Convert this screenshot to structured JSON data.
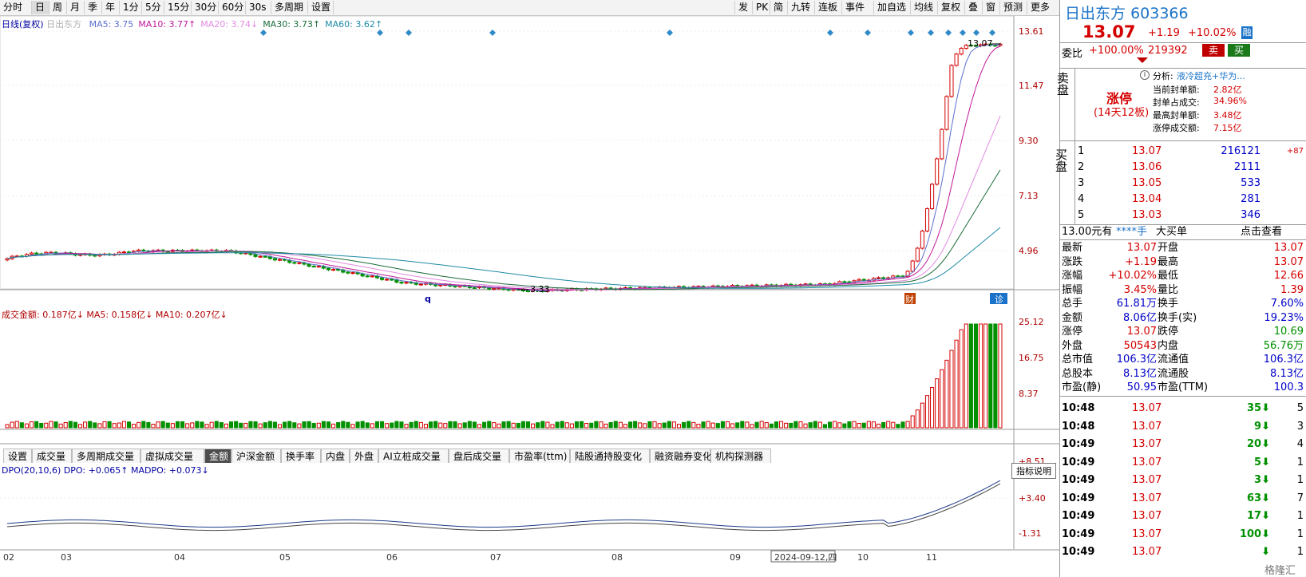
{
  "toolbar": {
    "left": [
      "分时",
      "日",
      "周",
      "月",
      "季",
      "年",
      "1分",
      "5分",
      "15分",
      "30分",
      "60分",
      "30s",
      "多周期",
      "设置"
    ],
    "active": "日",
    "right": [
      "发",
      "PK",
      "简",
      "九转",
      "连板",
      "事件",
      "加自选",
      "均线",
      "复权",
      "叠",
      "窗",
      "预测",
      "更多"
    ]
  },
  "main_chart": {
    "legend_title": "日线(复权)",
    "legend_stock": "日出东方",
    "ma": [
      {
        "label": "MA5: 3.75",
        "color": "#5a6fd0"
      },
      {
        "label": "MA10: 3.77↑",
        "color": "#c0189a"
      },
      {
        "label": "MA20: 3.74↓",
        "color": "#e08ae0"
      },
      {
        "label": "MA30: 3.73↑",
        "color": "#1b6b3a"
      },
      {
        "label": "MA60: 3.62↑",
        "color": "#1e8aa6"
      }
    ],
    "y_ticks": [
      "13.61",
      "11.47",
      "9.30",
      "7.13",
      "4.96"
    ],
    "high_label": "13.07",
    "low_label": "3.33",
    "x_labels": [
      "02",
      "03",
      "04",
      "05",
      "06",
      "07",
      "08",
      "09",
      "2024-09-12,四",
      "10",
      "11"
    ],
    "marker_q": "q",
    "badge_cai": "财",
    "badge_zhen": "诊"
  },
  "volume": {
    "legend": "成交金额: 0.187亿↓ MA5: 0.158亿↓ MA10: 0.207亿↓",
    "y_ticks": [
      "25.12",
      "16.75",
      "8.37"
    ]
  },
  "indicator_tabs": [
    "设置",
    "成交量",
    "多周期成交量",
    "虚拟成交量",
    "金额",
    "沪深金额",
    "换手率",
    "内盘",
    "外盘",
    "AI立桩成交量",
    "盘后成交量",
    "市盈率(ttm)",
    "陆股通持股变化",
    "融资融券变化",
    "机构探测器"
  ],
  "indicator_active": "金额",
  "dpo": {
    "legend": "DPO(20,10,6) DPO: +0.065↑ MADPO: +0.073↓",
    "button": "指标说明",
    "y_ticks": [
      "+8.51",
      "+3.40",
      "-1.31"
    ]
  },
  "quote": {
    "name": "日出东方",
    "code": "603366",
    "price": "13.07",
    "change": "+1.19",
    "pct": "+10.02%",
    "tag": "融",
    "weibi_label": "委比",
    "weibi_value": "+100.00%",
    "weibi_vol": "219392",
    "sell_btn": "卖",
    "buy_btn": "买",
    "sell_side": "卖盘",
    "zhangting": "涨停",
    "zhangting_sub": "(14天12板)",
    "analysis_label": "分析:",
    "analysis_text": "液冷超充+华为...",
    "stats": [
      {
        "k": "当前封单额:",
        "v": "2.82亿"
      },
      {
        "k": "封单占成交:",
        "v": "34.96%"
      },
      {
        "k": "最高封单额:",
        "v": "3.48亿"
      },
      {
        "k": "涨停成交额:",
        "v": "7.15亿"
      }
    ],
    "buy_side": "买盘",
    "bids": [
      {
        "lvl": "1",
        "price": "13.07",
        "vol": "216121",
        "chg": "+87"
      },
      {
        "lvl": "2",
        "price": "13.06",
        "vol": "2111",
        "chg": ""
      },
      {
        "lvl": "3",
        "price": "13.05",
        "vol": "533",
        "chg": ""
      },
      {
        "lvl": "4",
        "price": "13.04",
        "vol": "281",
        "chg": ""
      },
      {
        "lvl": "5",
        "price": "13.03",
        "vol": "346",
        "chg": ""
      }
    ],
    "big_order": {
      "a": "13.00元有",
      "b": "****手",
      "c": "大买单",
      "d": "点击查看"
    },
    "details": [
      {
        "k1": "最新",
        "v1": "13.07",
        "k2": "开盘",
        "v2": "13.07",
        "c1": "red",
        "c2": "red"
      },
      {
        "k1": "涨跌",
        "v1": "+1.19",
        "k2": "最高",
        "v2": "13.07",
        "c1": "red",
        "c2": "red"
      },
      {
        "k1": "涨幅",
        "v1": "+10.02%",
        "k2": "最低",
        "v2": "12.66",
        "c1": "red",
        "c2": "red"
      },
      {
        "k1": "振幅",
        "v1": "3.45%",
        "k2": "量比",
        "v2": "1.39",
        "c1": "red",
        "c2": "red"
      },
      {
        "k1": "总手",
        "v1": "61.81万",
        "k2": "换手",
        "v2": "7.60%",
        "c1": "blue",
        "c2": "blue"
      },
      {
        "k1": "金额",
        "v1": "8.06亿",
        "k2": "换手(实)",
        "v2": "19.23%",
        "c1": "blue",
        "c2": "blue"
      },
      {
        "k1": "涨停",
        "v1": "13.07",
        "k2": "跌停",
        "v2": "10.69",
        "c1": "red",
        "c2": "green"
      },
      {
        "k1": "外盘",
        "v1": "50543",
        "k2": "内盘",
        "v2": "56.76万",
        "c1": "red",
        "c2": "green"
      },
      {
        "k1": "总市值",
        "v1": "106.3亿",
        "k2": "流通值",
        "v2": "106.3亿",
        "c1": "blue",
        "c2": "blue"
      },
      {
        "k1": "总股本",
        "v1": "8.13亿",
        "k2": "流通股",
        "v2": "8.13亿",
        "c1": "blue",
        "c2": "blue"
      },
      {
        "k1": "市盈(静)",
        "v1": "50.95",
        "k2": "市盈(TTM)",
        "v2": "100.3",
        "c1": "blue",
        "c2": "blue"
      }
    ],
    "ticks": [
      {
        "t": "10:48",
        "p": "13.07",
        "v": "35",
        "d": "5"
      },
      {
        "t": "10:48",
        "p": "13.07",
        "v": "9",
        "d": "3"
      },
      {
        "t": "10:49",
        "p": "13.07",
        "v": "20",
        "d": "4"
      },
      {
        "t": "10:49",
        "p": "13.07",
        "v": "5",
        "d": "1"
      },
      {
        "t": "10:49",
        "p": "13.07",
        "v": "3",
        "d": "1"
      },
      {
        "t": "10:49",
        "p": "13.07",
        "v": "63",
        "d": "7"
      },
      {
        "t": "10:49",
        "p": "13.07",
        "v": "17",
        "d": "1"
      },
      {
        "t": "10:49",
        "p": "13.07",
        "v": "100",
        "d": "1"
      },
      {
        "t": "10:49",
        "p": "13.07",
        "v": "",
        "d": "1"
      }
    ],
    "watermark": "格隆汇"
  }
}
